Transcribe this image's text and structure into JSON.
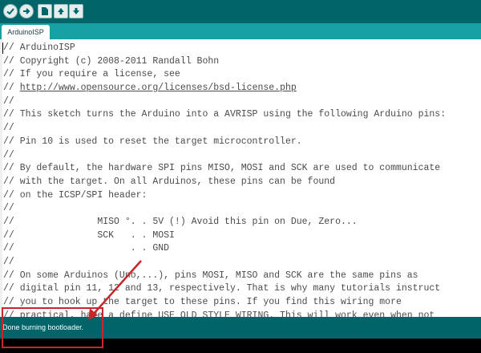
{
  "toolbar": {
    "buttons": [
      {
        "name": "verify-button",
        "icon": "check-icon"
      },
      {
        "name": "upload-button",
        "icon": "arrow-right-icon"
      },
      {
        "name": "new-button",
        "icon": "new-file-icon"
      },
      {
        "name": "open-button",
        "icon": "arrow-up-icon"
      },
      {
        "name": "save-button",
        "icon": "arrow-down-icon"
      }
    ]
  },
  "tabs": [
    {
      "label": "ArduinoISP"
    }
  ],
  "editor": {
    "lines": [
      "// ArduinoISP",
      "// Copyright (c) 2008-2011 Randall Bohn",
      "// If you require a license, see",
      "// http://www.opensource.org/licenses/bsd-license.php",
      "//",
      "// This sketch turns the Arduino into a AVRISP using the following Arduino pins:",
      "//",
      "// Pin 10 is used to reset the target microcontroller.",
      "//",
      "// By default, the hardware SPI pins MISO, MOSI and SCK are used to communicate",
      "// with the target. On all Arduinos, these pins can be found",
      "// on the ICSP/SPI header:",
      "//",
      "//               MISO °. . 5V (!) Avoid this pin on Due, Zero...",
      "//               SCK   . . MOSI",
      "//                     . . GND",
      "//",
      "// On some Arduinos (Uno,...), pins MOSI, MISO and SCK are the same pins as",
      "// digital pin 11, 12 and 13, respectively. That is why many tutorials instruct",
      "// you to hook up the target to these pins. If you find this wiring more",
      "// practical, have a define USE_OLD_STYLE_WIRING. This will work even when not"
    ],
    "link_prefix": "// ",
    "link_text": "http://www.opensource.org/licenses/bsd-license.php"
  },
  "status": {
    "message": "Done burning bootloader."
  },
  "colors": {
    "toolbar": "#006468",
    "tabbar": "#17a1a5",
    "annotation": "#c8262a"
  }
}
